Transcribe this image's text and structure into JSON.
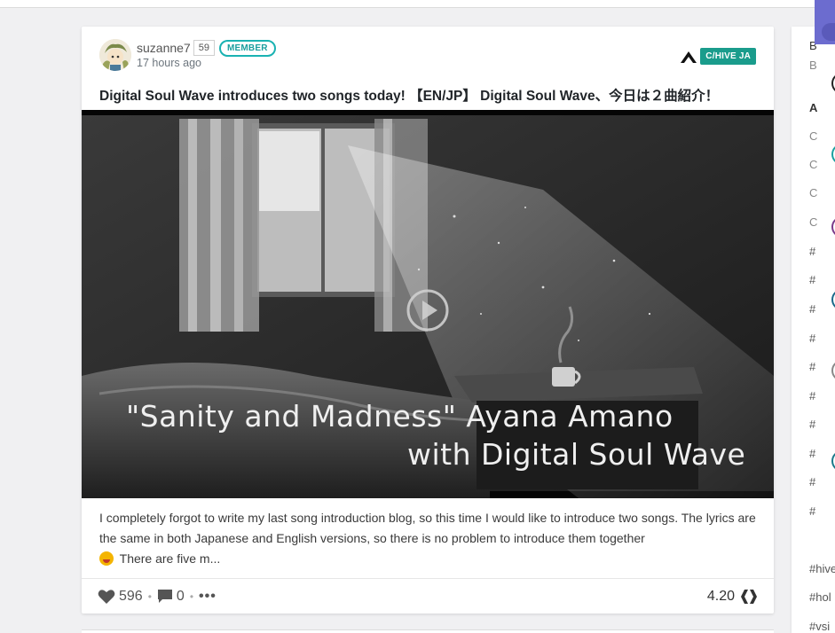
{
  "post": {
    "author": "suzanne7",
    "reputation": "59",
    "role_badge": "MEMBER",
    "time": "17 hours ago",
    "community": "C/HIVE JA",
    "title": "Digital Soul Wave introduces two songs today!  【EN/JP】 Digital Soul Wave、今日は２曲紹介！",
    "video_caption_line1": "\"Sanity and Madness\"  Ayana Amano",
    "video_caption_line2": "with Digital Soul Wave",
    "excerpt": "I completely forgot to write my last song introduction blog, so this time I would like to introduce two songs. The lyrics are the same in both Japanese and English versions, so there is no problem to introduce them together",
    "excerpt_tail": "There are five m...",
    "votes": "596",
    "comments": "0",
    "more": "•••",
    "payout": "4.20"
  },
  "sidebar": {
    "letters": [
      "B",
      "B",
      "A",
      "C",
      "C",
      "C",
      "C"
    ],
    "hashtags": [
      "#",
      "#",
      "#",
      "#",
      "#",
      "#",
      "#",
      "#",
      "#",
      "#",
      "#hive",
      "#hol",
      "#vsi"
    ]
  },
  "colors": {
    "accent_teal": "#1ab2b2",
    "community_tag": "#1a9c8c",
    "background": "#f0f0f2"
  }
}
